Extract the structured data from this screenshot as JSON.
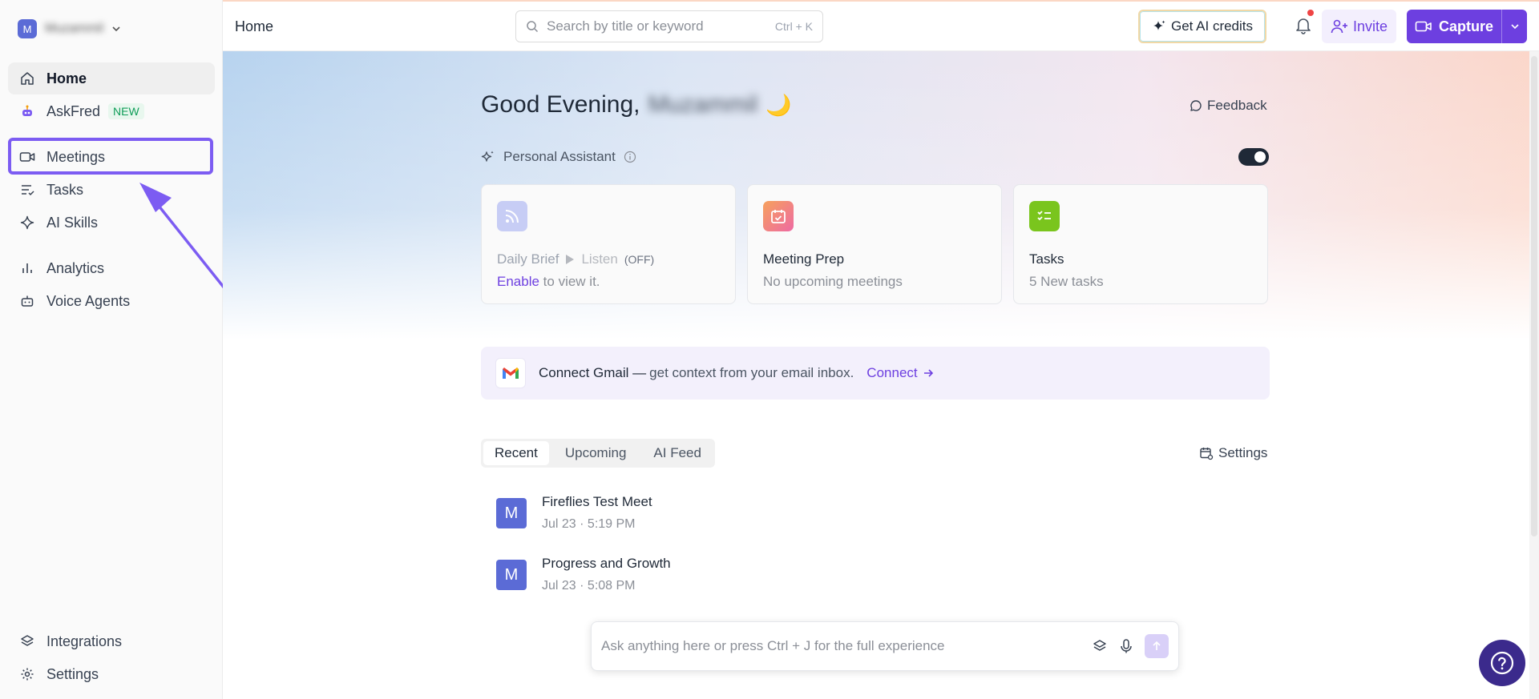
{
  "workspace": {
    "initial": "M",
    "name": "Muzammil"
  },
  "sidebar": {
    "items": [
      {
        "label": "Home",
        "icon": "home-icon"
      },
      {
        "label": "AskFred",
        "badge": "NEW",
        "icon": "robot-icon"
      },
      {
        "label": "Meetings",
        "icon": "video-camera-icon"
      },
      {
        "label": "Tasks",
        "icon": "checklist-icon"
      },
      {
        "label": "AI Skills",
        "icon": "sparkle-icon"
      },
      {
        "label": "Analytics",
        "icon": "bar-chart-icon"
      },
      {
        "label": "Voice Agents",
        "icon": "bot-icon"
      }
    ],
    "bottom": [
      {
        "label": "Integrations",
        "icon": "layers-icon"
      },
      {
        "label": "Settings",
        "icon": "gear-icon"
      }
    ]
  },
  "header": {
    "breadcrumb": "Home",
    "search_placeholder": "Search by title or keyword",
    "search_shortcut": "Ctrl + K",
    "credits_label": "Get AI credits",
    "invite_label": "Invite",
    "capture_label": "Capture"
  },
  "main": {
    "greeting": "Good Evening,",
    "user_name": "Muzammil",
    "greeting_emoji": "🌙",
    "feedback_label": "Feedback",
    "assistant_label": "Personal Assistant",
    "assistant_enabled": true,
    "cards": [
      {
        "title": "Daily Brief",
        "listen": "Listen",
        "status": "(OFF)",
        "link": "Enable",
        "sub": "to view it."
      },
      {
        "title": "Meeting Prep",
        "sub": "No upcoming meetings"
      },
      {
        "title": "Tasks",
        "sub": "5 New tasks"
      }
    ],
    "gmail": {
      "title": "Connect Gmail —",
      "desc": "get context from your email inbox.",
      "connect": "Connect"
    },
    "tabs": [
      "Recent",
      "Upcoming",
      "AI Feed"
    ],
    "active_tab": "Recent",
    "settings_label": "Settings",
    "meetings": [
      {
        "initial": "M",
        "title": "Fireflies Test Meet",
        "date": "Jul 23",
        "time": "5:19 PM"
      },
      {
        "initial": "M",
        "title": "Progress and Growth",
        "date": "Jul 23",
        "time": "5:08 PM"
      }
    ],
    "ask_placeholder": "Ask anything here or press Ctrl + J for the full experience"
  },
  "colors": {
    "accent": "#6d3fe0",
    "highlight": "#7c5cf2",
    "avatar": "#5b6bd6"
  }
}
